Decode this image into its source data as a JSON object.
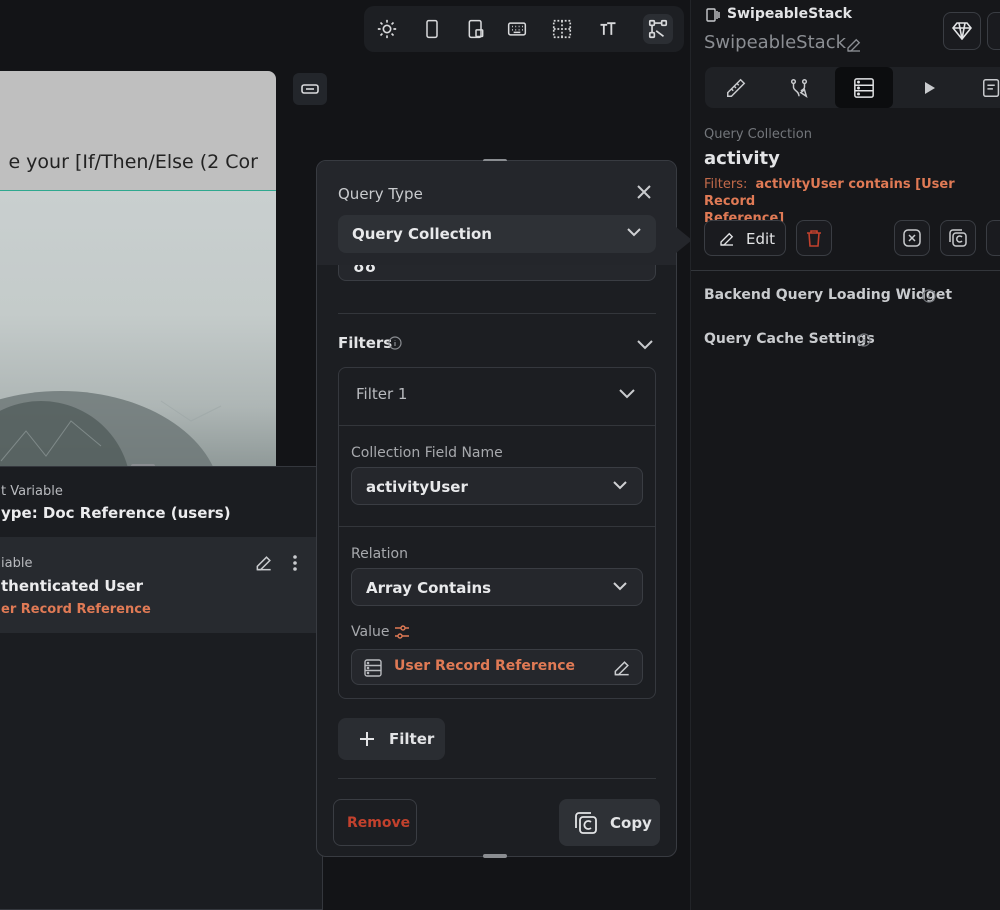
{
  "canvas": {
    "phone_title": "e your [If/Then/Else (2 Cor",
    "toolbar_icons": [
      "sun-icon",
      "phone-icon",
      "tablet-icon",
      "keyboard-icon",
      "grid-icon",
      "text-size-icon",
      "widget-tree-icon"
    ]
  },
  "variable_panel": {
    "section_label": "t Variable",
    "type_label": "ype: Doc Reference (users)",
    "item_label": "iable",
    "item_title": "thenticated User",
    "item_value": "er Record Reference"
  },
  "query_panel": {
    "query_type_label": "Query Type",
    "query_type_value": "Query Collection",
    "hidden_field_partial": "ʊʊ",
    "filters_label": "Filters",
    "filter1_label": "Filter 1",
    "collection_field_label": "Collection Field Name",
    "collection_field_value": "activityUser",
    "relation_label": "Relation",
    "relation_value": "Array Contains",
    "value_label": "Value",
    "value_value": "User Record Reference",
    "add_filter_label": "Filter",
    "remove_label": "Remove",
    "copy_label": "Copy"
  },
  "right_panel": {
    "widget_type": "SwipeableStack",
    "widget_name": "SwipeableStack",
    "query_kind": "Query Collection",
    "collection_name": "activity",
    "filters_prefix": "Filters:",
    "filters_text_line1": "activityUser contains [User Record",
    "filters_text_line2": "Reference]",
    "edit_label": "Edit",
    "loading_widget_label": "Backend Query Loading Widget",
    "cache_settings_label": "Query Cache Settings"
  },
  "colors": {
    "accent_orange": "#e07a55",
    "panel_bg": "#1c1e22",
    "selection_teal": "#2fa88f",
    "delete_red": "#c2412d"
  }
}
